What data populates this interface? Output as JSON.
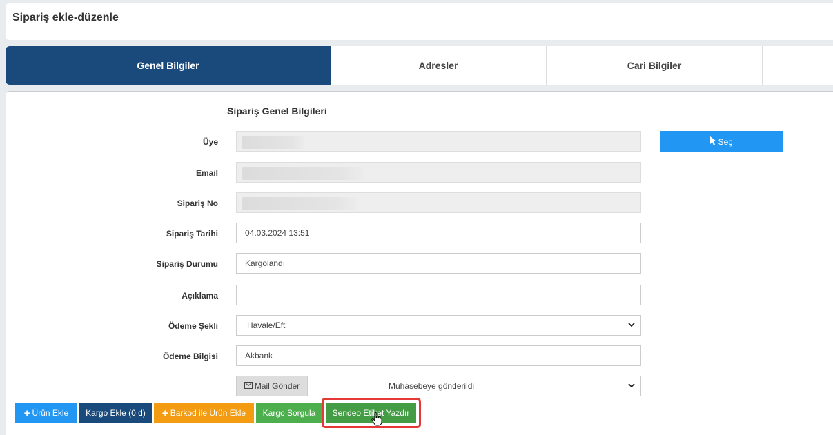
{
  "header": {
    "title": "Sipariş ekle-düzenle"
  },
  "tabs": [
    {
      "label": "Genel Bilgiler",
      "active": true
    },
    {
      "label": "Adresler",
      "active": false
    },
    {
      "label": "Cari Bilgiler",
      "active": false
    },
    {
      "label": "",
      "active": false
    }
  ],
  "form": {
    "section_title": "Sipariş Genel Bilgileri",
    "uye": {
      "label": "Üye",
      "value": ""
    },
    "email": {
      "label": "Email",
      "value": ""
    },
    "siparis_no": {
      "label": "Sipariş No",
      "value": ""
    },
    "siparis_tarihi": {
      "label": "Sipariş Tarihi",
      "value": "04.03.2024 13:51"
    },
    "siparis_durumu": {
      "label": "Sipariş Durumu",
      "value": "Kargolandı"
    },
    "aciklama": {
      "label": "Açıklama",
      "value": ""
    },
    "odeme_sekli": {
      "label": "Ödeme Şekli",
      "value": "Havale/Eft"
    },
    "odeme_bilgisi": {
      "label": "Ödeme Bilgisi",
      "value": "Akbank"
    },
    "sec_button": "Seç",
    "mail_button": "Mail Gönder",
    "muhasebe_select": "Muhasebeye gönderildi"
  },
  "actions": {
    "urun_ekle": "Ürün Ekle",
    "kargo_ekle": "Kargo Ekle (0 d)",
    "barkod": "Barkod ile Ürün Ekle",
    "kargo_sorgula": "Kargo Sorgula",
    "sendeo": "Sendeo Etiket Yazdır"
  },
  "colors": {
    "tab_active": "#1a4a7c",
    "primary": "#2196f3",
    "dark": "#1a4a7c",
    "warning": "#f39c12",
    "success": "#4cae4c",
    "highlight": "#e53935"
  }
}
